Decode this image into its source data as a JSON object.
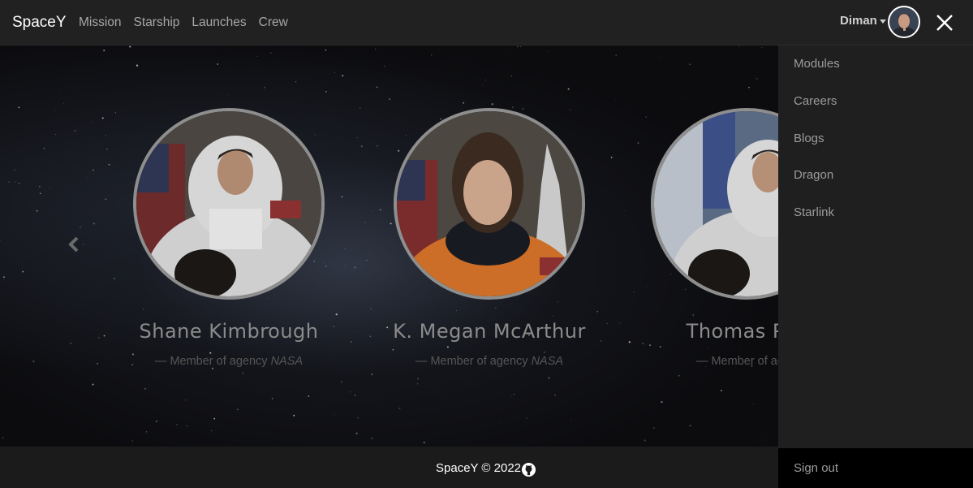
{
  "navbar": {
    "brand": "SpaceY",
    "links": [
      "Mission",
      "Starship",
      "Launches",
      "Crew"
    ],
    "user_name": "Diman"
  },
  "crew": [
    {
      "name": "Shane Kimbrough",
      "role_prefix": "— Member of agency",
      "agency": "NASA",
      "suit_color": "#dcdcdc"
    },
    {
      "name": "K. Megan McArthur",
      "role_prefix": "— Member of agency",
      "agency": "NASA",
      "suit_color": "#d9792b"
    },
    {
      "name": "Thomas Pes",
      "role_prefix": "— Member of agen",
      "agency": "",
      "suit_color": "#dcdcdc"
    }
  ],
  "sidebar": {
    "items": [
      "Modules",
      "Careers",
      "Blogs",
      "Dragon",
      "Starlink"
    ],
    "sign_out": "Sign out"
  },
  "footer": {
    "text": "SpaceY © 2022"
  },
  "colors": {
    "navbar_bg": "#212121",
    "sidebar_bg": "#1f1f1f",
    "photo_ring": "#8e8e8e"
  }
}
